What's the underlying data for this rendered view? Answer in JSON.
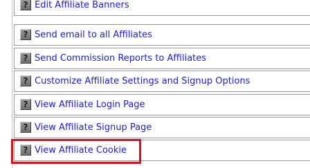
{
  "menu": {
    "items": [
      {
        "label": "Edit Affiliate Banners",
        "icon": "help-icon",
        "icon_glyph": "?"
      },
      {
        "label": "Send email to all Affiliates",
        "icon": "help-icon",
        "icon_glyph": "?"
      },
      {
        "label": "Send Commission Reports to Affiliates",
        "icon": "help-icon",
        "icon_glyph": "?"
      },
      {
        "label": "Customize Affiliate Settings and Signup Options",
        "icon": "help-icon",
        "icon_glyph": "?"
      },
      {
        "label": "View Affiliate Login Page",
        "icon": "help-icon",
        "icon_glyph": "?"
      },
      {
        "label": "View Affiliate Signup Page",
        "icon": "help-icon",
        "icon_glyph": "?"
      },
      {
        "label": "View Affiliate Cookie",
        "icon": "help-icon",
        "icon_glyph": "?",
        "highlighted": true
      }
    ]
  },
  "colors": {
    "link": "#1d1dc8",
    "highlight": "#d2141a",
    "icon": "#7f7f7f",
    "border": "#9a9a9a"
  }
}
